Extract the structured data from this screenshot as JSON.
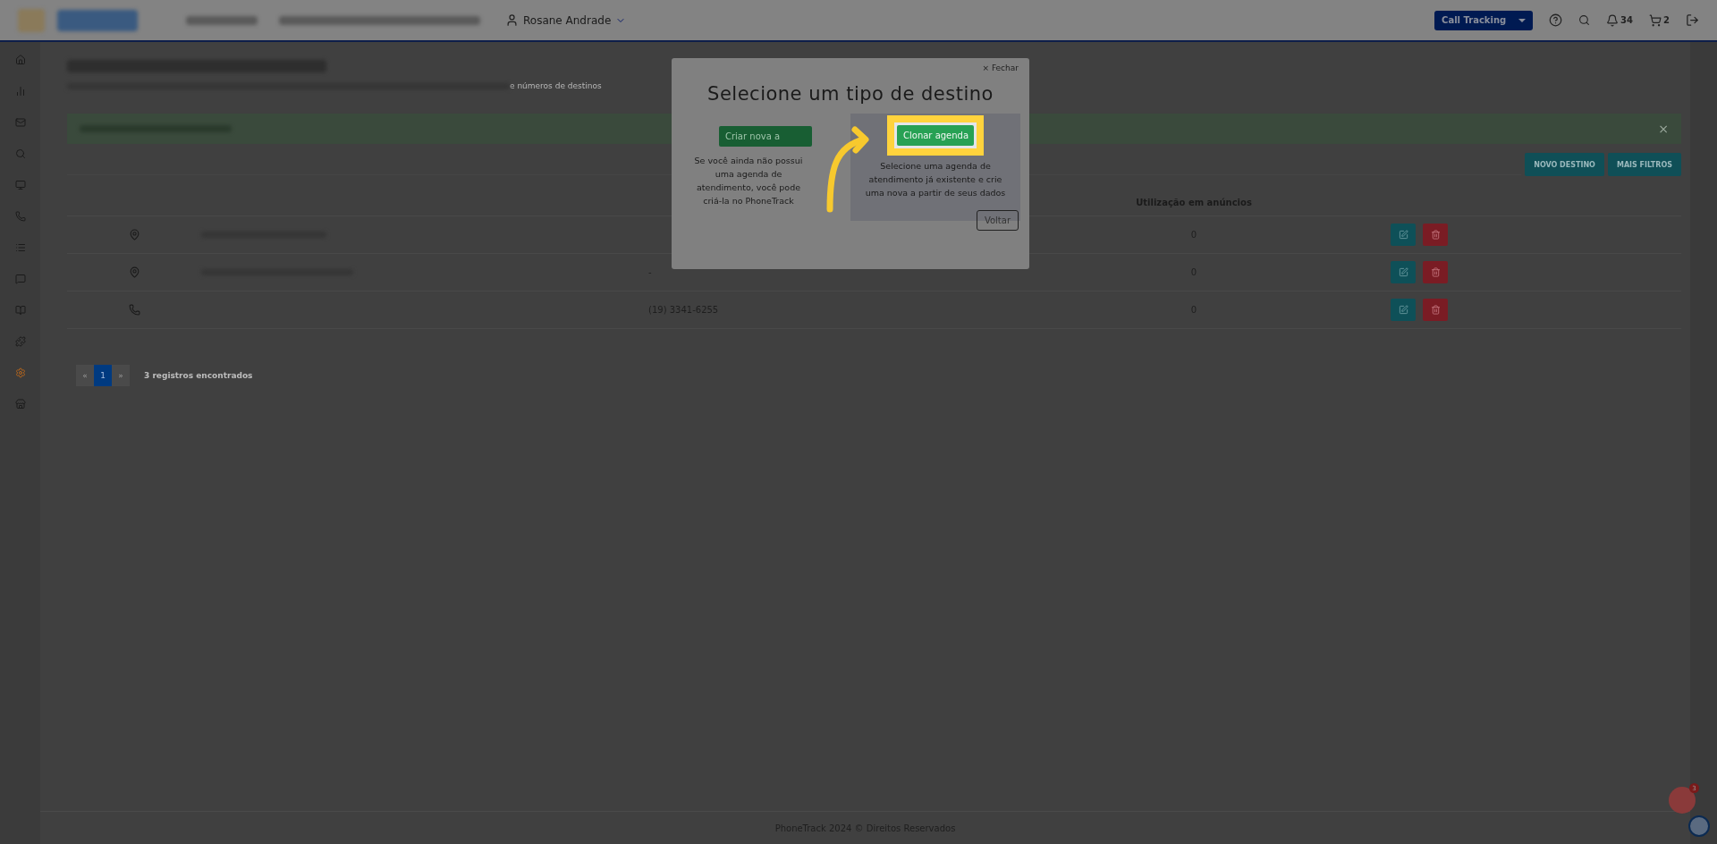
{
  "header": {
    "user_name": "Rosane Andrade",
    "product_select": "Call Tracking",
    "notifications_count": "34",
    "cart_count": "2"
  },
  "sidebar": {
    "items": [
      {
        "selected": false
      },
      {
        "selected": false
      },
      {
        "selected": false
      },
      {
        "selected": false
      },
      {
        "selected": false
      },
      {
        "selected": false
      },
      {
        "selected": false
      },
      {
        "selected": false
      },
      {
        "selected": false
      },
      {
        "selected": false
      },
      {
        "selected": true
      },
      {
        "selected": false
      }
    ]
  },
  "page": {
    "subtitle_fragment": "e números de destinos"
  },
  "alert": {
    "close": "×"
  },
  "toolbar": {
    "buttons": [
      "NOVO DESTINO",
      "MAIS FILTROS"
    ]
  },
  "table": {
    "usage_header": "Utilização em anúncios",
    "rows": [
      {
        "kind": "pin",
        "usage": "0"
      },
      {
        "kind": "pin",
        "phone": "-",
        "usage": "0"
      },
      {
        "kind": "phone",
        "phone": "(19) 3341-6255",
        "usage": "0"
      }
    ]
  },
  "pagination": {
    "prev": "«",
    "pages": [
      {
        "label": "1",
        "selected": true
      }
    ],
    "next": "»",
    "summary": "3 registros encontrados"
  },
  "footer": "PhoneTrack 2024 © Direitos Reservados",
  "chat_badge": "3",
  "modal": {
    "close": "× Fechar",
    "title": "Selecione um tipo de destino",
    "options": [
      {
        "button": "Criar nova a",
        "description": "Se você ainda não possui uma agenda de atendimento, você pode criá-la no PhoneTrack",
        "highlighted": false
      },
      {
        "button": "Clonar agenda",
        "description": "Selecione uma agenda de atendimento já existente e crie uma nova a partir de seus dados",
        "highlighted": true
      }
    ],
    "back": "Voltar"
  }
}
